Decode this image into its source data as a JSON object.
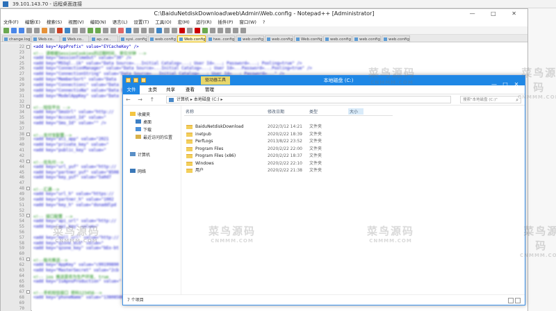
{
  "remote": {
    "title": "39.101.143.70 - 远程桌面连接",
    "controls": "— □ ✕"
  },
  "npp": {
    "title": "C:\\BaiduNetdiskDownload\\web\\Admin\\Web.config - Notepad++ [Administrator]",
    "controls": "— □ ✕",
    "menu": [
      "文件(F)",
      "编辑(E)",
      "搜索(S)",
      "视图(V)",
      "编码(N)",
      "语言(L)",
      "设置(T)",
      "工具(O)",
      "宏(M)",
      "运行(R)",
      "插件(P)",
      "窗口(W)",
      "?"
    ],
    "tabs": [
      "change.log",
      "Web.co..",
      "Web.co..",
      "ap..ce..",
      "sysi..config",
      "web.config",
      "twe..config",
      "web.config",
      "web.config",
      "Web.config",
      "web.config",
      "web.config",
      "web.config"
    ],
    "active_tab": "Web.config",
    "line_numbers": [
      "22",
      "23",
      "24",
      "25",
      "26",
      "27",
      "28",
      "29",
      "30",
      "31",
      "32",
      "33",
      "34",
      "35",
      "36",
      "37",
      "38",
      "39",
      "40",
      "41",
      "42",
      "43",
      "44",
      "45",
      "46",
      "47",
      "48",
      "49",
      "50",
      "51",
      "52",
      "53",
      "54",
      "55",
      "56",
      "57",
      "58",
      "59",
      "60",
      "61",
      "62",
      "63",
      "64",
      "65",
      "66",
      "67",
      "68",
      "69",
      "70"
    ],
    "code": [
      "<add key=\"AppPrefix\" value=\"EYCacheKey\" />",
      "<!-- 请根据SessionCookies的过期时间, 单位分钟 -->",
      "<add key=\"SessionTimeOut\" value=\"30\" />",
      "<add key=\"MSSql..ik\" value=\"Data Source=...Initial Catalog=...; User Id=...; Password=...; Pooling=true\" />",
      "<add key=\"ConnectionManager\" value=\"Data Source=...Initial Catalog=...; User Id=...Password=...Pooling=true\" />",
      "<add key=\"ConnectionString\" value=\"Data Source=...Initial Catalog=...; User Id=...; Password=...\" />",
      "<add key=\"MemberSort\" value=\"Data",
      "<add key=\"Connectioni\" value=\"Data",
      "<add key=\"ConnectioNa\" value=\"Data S",
      "<add key=\"ModelAppKey\" value=\"Data",
      "",
      "<!--短信平台 -->",
      "<add key=\"SmsUrl\" value=\"http://",
      "<add key=\"Account_Id\" value=\"",
      "<add key=\"Sms_Id\" value=\"\" />",
      "",
      "<!--支付宝配置-->",
      "<add key=\"ali_app\" value=\"2021",
      "<add key=\"private_key\" value=\"",
      "<add key=\"public_key\" value=\"",
      "",
      "<!--优先付-->",
      "<add key=\"url_yuf\" value=\"http://",
      "<add key=\"partner_yuf\" value=\"8508",
      "<add key=\"key_yuf\" value=\"5a0d7",
      "",
      "<!--汇通-->",
      "<add key=\"url_h\" value=\"https://",
      "<add key=\"partner_h\" value=\"1002",
      "<add key=\"key_h\" value=\"dsnaddlpd",
      "",
      "<!-- 接口配置 -->",
      "<add key=\"api_url\" value=\"http://",
      "<add key=\"api_key\" value=\"",
      "",
      "<add key=\"mall_url\" value=\"http://",
      "<add key=\"qzone_mid\" value=\"",
      "<add key=\"qzone_key\" value=\"bEo-bt",
      "",
      "<!--极光推送-->",
      "<add key=\"AppKey\" value=\"c99199890",
      "<add key=\"MasterSecret\" value=\"2cb",
      "<!-- ios 推送是否为生产环境, true",
      "<add key=\"IsApnsProduction\" value=\"",
      "",
      "<!--手机短信接口 密码123456-->",
      "<add key=\"phoneName\" value=\"13808580890\" />"
    ]
  },
  "explorer": {
    "context_tab": "驱动器工具",
    "title": "本地磁盘 (C:)",
    "controls": "— □ ✕",
    "ribbon": {
      "file": "文件",
      "home": "主页",
      "share": "共享",
      "view": "查看",
      "manage": "管理"
    },
    "address": "计算机 ▸ 本地磁盘 (C:) ▸",
    "search_placeholder": "搜索\"本地磁盘 (C:)\"",
    "nav": {
      "favorites": "收藏夹",
      "desktop": "桌面",
      "downloads": "下载",
      "recent": "最近访问的位置",
      "computer": "计算机",
      "network": "网络"
    },
    "columns": {
      "name": "名称",
      "date": "修改日期",
      "type": "类型",
      "size": "大小"
    },
    "files": [
      {
        "name": "BaiduNetdiskDownload",
        "date": "2022/3/12 14:21",
        "type": "文件夹"
      },
      {
        "name": "inetpub",
        "date": "2020/2/22 18:39",
        "type": "文件夹"
      },
      {
        "name": "PerfLogs",
        "date": "2013/8/22 23:52",
        "type": "文件夹"
      },
      {
        "name": "Program Files",
        "date": "2020/2/22 22:00",
        "type": "文件夹"
      },
      {
        "name": "Program Files (x86)",
        "date": "2020/2/22 18:37",
        "type": "文件夹"
      },
      {
        "name": "Windows",
        "date": "2020/2/22 22:10",
        "type": "文件夹"
      },
      {
        "name": "用户",
        "date": "2020/2/22 21:38",
        "type": "文件夹"
      }
    ],
    "status": "7 个项目"
  },
  "watermark": {
    "text": "菜鸟源码",
    "url": "CNMMM.COM"
  }
}
